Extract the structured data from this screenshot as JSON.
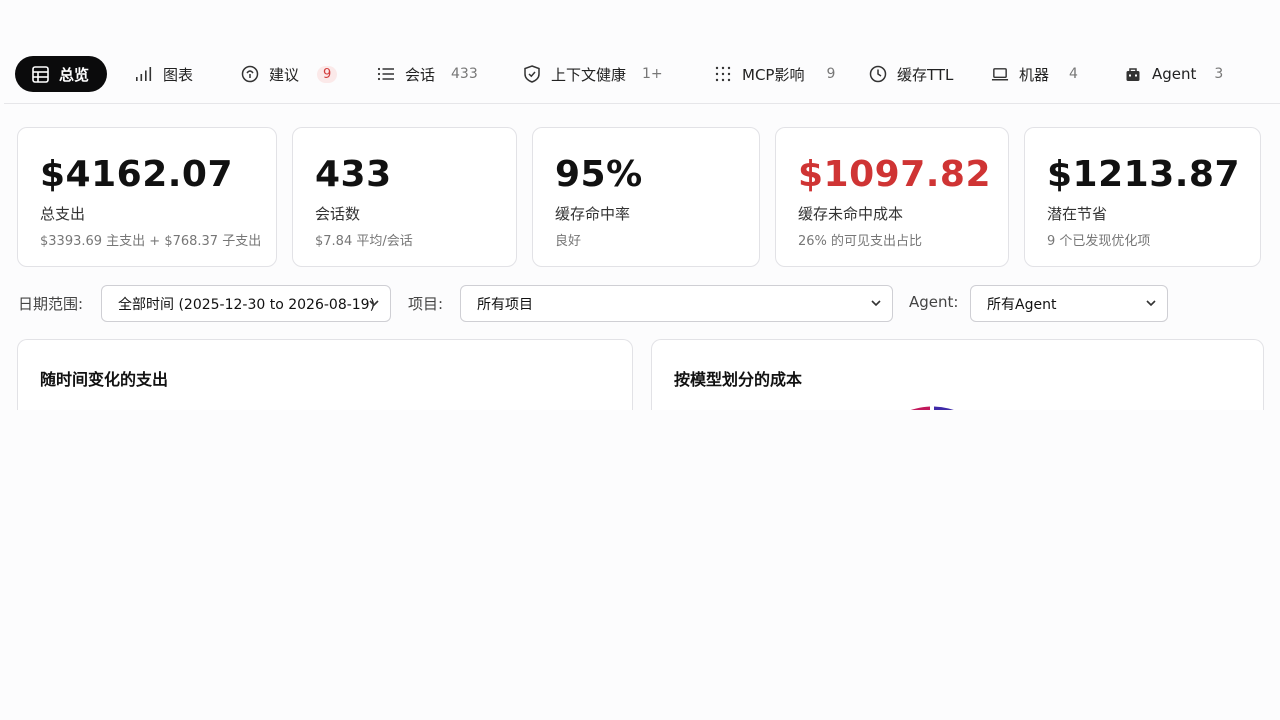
{
  "nav": {
    "tabs": [
      {
        "label": "总览",
        "count": "",
        "icon": "table-icon"
      },
      {
        "label": "图表",
        "count": "",
        "icon": "bar-chart-icon"
      },
      {
        "label": "建议",
        "count": "9",
        "icon": "lightbulb-icon"
      },
      {
        "label": "会话",
        "count": "433",
        "icon": "list-icon"
      },
      {
        "label": "上下文健康",
        "count": "1+",
        "icon": "shield-icon"
      },
      {
        "label": "MCP影响",
        "count": "9",
        "icon": "dots-grid-icon"
      },
      {
        "label": "缓存TTL",
        "count": "",
        "icon": "clock-icon"
      },
      {
        "label": "机器",
        "count": "4",
        "icon": "laptop-icon"
      },
      {
        "label": "Agent",
        "count": "3",
        "icon": "bot-icon"
      }
    ]
  },
  "stats": [
    {
      "value": "$4162.07",
      "label": "总支出",
      "sub": "$3393.69 主支出 + $768.37 子支出"
    },
    {
      "value": "433",
      "label": "会话数",
      "sub": "$7.84 平均/会话"
    },
    {
      "value": "95%",
      "label": "缓存命中率",
      "sub": "良好"
    },
    {
      "value": "$1097.82",
      "label": "缓存未命中成本",
      "sub": "26% 的可见支出占比"
    },
    {
      "value": "$1213.87",
      "label": "潜在节省",
      "sub": "9 个已发现优化项"
    }
  ],
  "filters": {
    "date_label": "日期范围:",
    "date_value": "全部时间 (2025-12-30 to 2026-08-19)",
    "project_label": "项目:",
    "project_value": "所有项目",
    "agent_label": "Agent:",
    "agent_value": "所有Agent"
  },
  "panels": {
    "spend_title": "随时间变化的支出",
    "model_title": "按模型划分的成本"
  },
  "colors": {
    "accent_dark": "#0b0b0c",
    "danger": "#cf3434",
    "badge_bg": "#fbe9e9"
  }
}
